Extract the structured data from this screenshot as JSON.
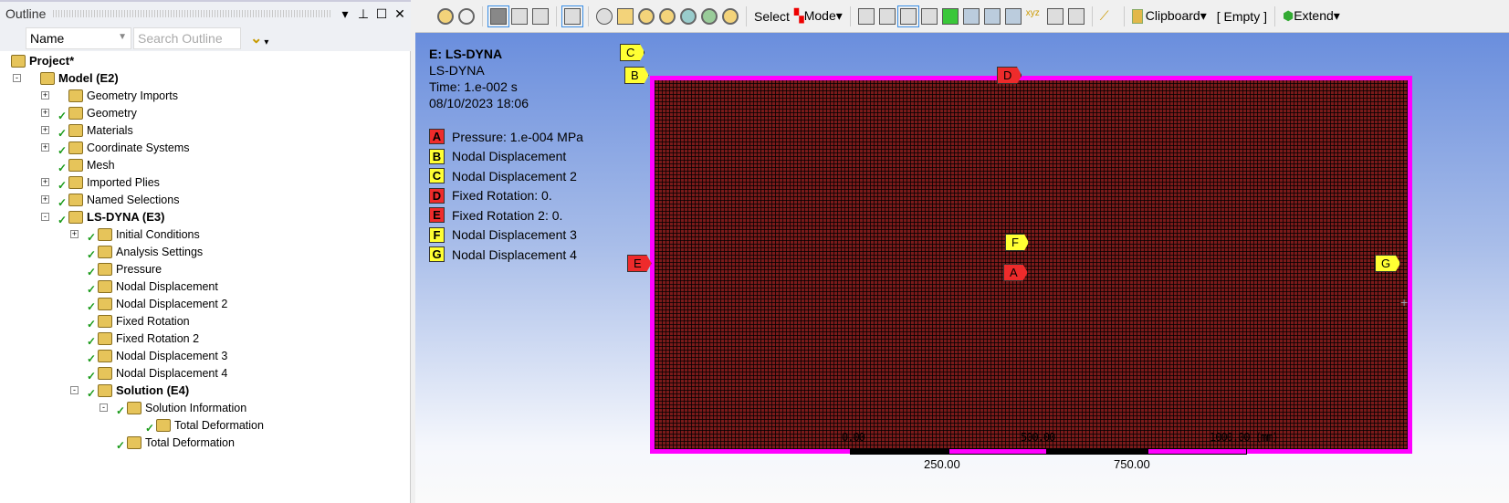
{
  "outline": {
    "title": "Outline",
    "filter_select": "Name",
    "search_placeholder": "Search Outline"
  },
  "tree": [
    {
      "label": "Project*",
      "level": 0,
      "bold": true,
      "exp": ""
    },
    {
      "label": "Model (E2)",
      "level": 1,
      "bold": true,
      "exp": "-"
    },
    {
      "label": "Geometry Imports",
      "level": 2,
      "exp": "+"
    },
    {
      "label": "Geometry",
      "level": 2,
      "exp": "+",
      "check": true
    },
    {
      "label": "Materials",
      "level": 2,
      "exp": "+",
      "check": true
    },
    {
      "label": "Coordinate Systems",
      "level": 2,
      "exp": "+",
      "check": true
    },
    {
      "label": "Mesh",
      "level": 2,
      "exp": "",
      "check": true
    },
    {
      "label": "Imported Plies",
      "level": 2,
      "exp": "+",
      "check": true
    },
    {
      "label": "Named Selections",
      "level": 2,
      "exp": "+",
      "check": true
    },
    {
      "label": "LS-DYNA (E3)",
      "level": 2,
      "bold": true,
      "exp": "-",
      "check": true
    },
    {
      "label": "Initial Conditions",
      "level": 3,
      "exp": "+",
      "check": true
    },
    {
      "label": "Analysis Settings",
      "level": 3,
      "exp": "",
      "check": true
    },
    {
      "label": "Pressure",
      "level": 3,
      "exp": "",
      "check": true
    },
    {
      "label": "Nodal Displacement",
      "level": 3,
      "exp": "",
      "check": true
    },
    {
      "label": "Nodal Displacement 2",
      "level": 3,
      "exp": "",
      "check": true
    },
    {
      "label": "Fixed Rotation",
      "level": 3,
      "exp": "",
      "check": true
    },
    {
      "label": "Fixed Rotation 2",
      "level": 3,
      "exp": "",
      "check": true
    },
    {
      "label": "Nodal Displacement 3",
      "level": 3,
      "exp": "",
      "check": true
    },
    {
      "label": "Nodal Displacement 4",
      "level": 3,
      "exp": "",
      "check": true
    },
    {
      "label": "Solution (E4)",
      "level": 3,
      "bold": true,
      "exp": "-",
      "check": true
    },
    {
      "label": "Solution Information",
      "level": 4,
      "exp": "-",
      "check": true
    },
    {
      "label": "Total Deformation",
      "level": 5,
      "exp": "",
      "check": true
    },
    {
      "label": "Total Deformation",
      "level": 4,
      "exp": "",
      "check": true
    }
  ],
  "toolbar": {
    "select": "Select",
    "mode": "Mode",
    "clipboard": "Clipboard",
    "empty": "[ Empty ]",
    "extend": "Extend"
  },
  "viewport": {
    "title": "E: LS-DYNA",
    "subtitle": "LS-DYNA",
    "time": "Time: 1.e-002 s",
    "date": "08/10/2023 18:06"
  },
  "legend": [
    {
      "key": "A",
      "label": "Pressure: 1.e-004 MPa",
      "color": "#ee2b2b"
    },
    {
      "key": "B",
      "label": "Nodal Displacement",
      "color": "#ffff33"
    },
    {
      "key": "C",
      "label": "Nodal Displacement 2",
      "color": "#ffff33"
    },
    {
      "key": "D",
      "label": "Fixed Rotation: 0.",
      "color": "#ee2b2b"
    },
    {
      "key": "E",
      "label": "Fixed Rotation 2: 0.",
      "color": "#ee2b2b"
    },
    {
      "key": "F",
      "label": "Nodal Displacement 3",
      "color": "#ffff33"
    },
    {
      "key": "G",
      "label": "Nodal Displacement 4",
      "color": "#ffff33"
    }
  ],
  "scale": {
    "t0": "0.00",
    "t500": "500.00",
    "t1000": "1000.00 (mm)",
    "b250": "250.00",
    "b750": "750.00"
  }
}
